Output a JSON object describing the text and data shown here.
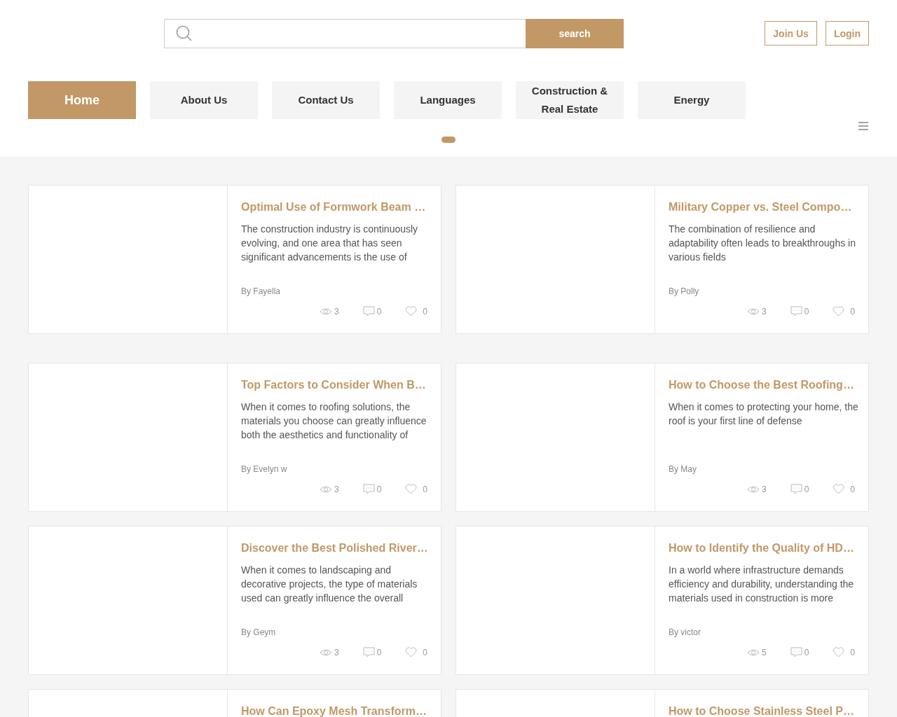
{
  "header": {
    "search": {
      "button": "search"
    },
    "buttons": [
      "Join Us",
      "Login"
    ]
  },
  "nav": {
    "tabs": [
      {
        "label": "Home",
        "selected": true
      },
      {
        "label": "About Us",
        "selected": false
      },
      {
        "label": "Contact Us",
        "selected": false
      },
      {
        "label": "Languages",
        "selected": false
      },
      {
        "label": "Construction & Real Estate",
        "selected": false
      },
      {
        "label": "Energy",
        "selected": false
      }
    ]
  },
  "articles": [
    {
      "title": "Optimal Use of Formwork Beam …",
      "excerpt": "The construction industry is continuously evolving, and one area that has seen significant advancements is the use of",
      "author": "By Fayella",
      "views": "3",
      "comments": "0",
      "likes": "0"
    },
    {
      "title": "Military Copper vs. Steel Compo…",
      "excerpt": "The combination of resilience and adaptability often leads to breakthroughs in various fields",
      "author": "By Polly",
      "views": "3",
      "comments": "0",
      "likes": "0"
    },
    {
      "title": "Top Factors to Consider When B…",
      "excerpt": "When it comes to roofing solutions, the materials you choose can greatly influence both the aesthetics and functionality of",
      "author": "By Evelyn w",
      "views": "3",
      "comments": "0",
      "likes": "0"
    },
    {
      "title": "How to Choose the Best Roofing…",
      "excerpt": "When it comes to protecting your home, the roof is your first line of defense",
      "author": "By May",
      "views": "3",
      "comments": "0",
      "likes": "0"
    },
    {
      "title": "Discover the Best Polished River…",
      "excerpt": "When it comes to landscaping and decorative projects, the type of materials used can greatly influence the overall",
      "author": "By Geym",
      "views": "3",
      "comments": "0",
      "likes": "0"
    },
    {
      "title": "How to Identify the Quality of HD…",
      "excerpt": "In a world where infrastructure demands efficiency and durability, understanding the materials used in construction is more",
      "author": "By victor",
      "views": "5",
      "comments": "0",
      "likes": "0"
    },
    {
      "title": "How Can Epoxy Mesh Transform…"
    },
    {
      "title": "How to Choose Stainless Steel P…"
    }
  ]
}
